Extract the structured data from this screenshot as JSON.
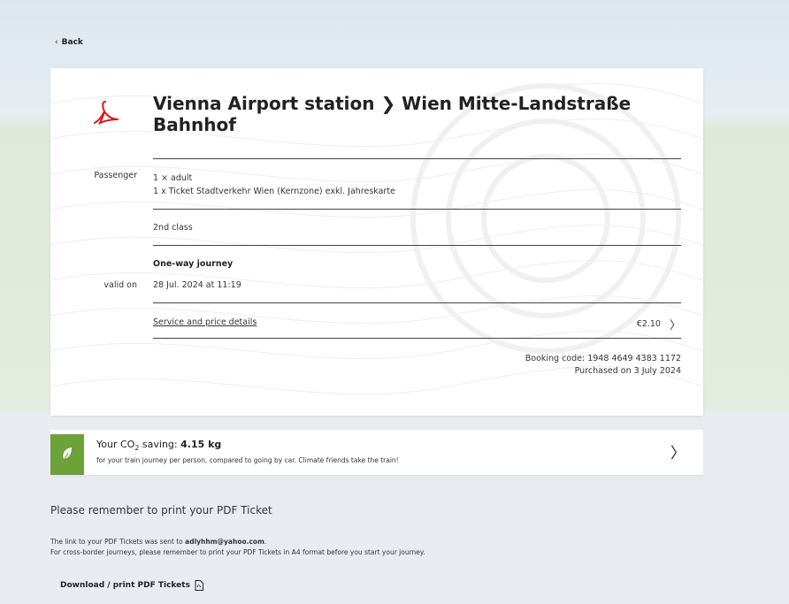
{
  "nav": {
    "back_label": "Back"
  },
  "ticket": {
    "title": "Vienna Airport station ❯ Wien Mitte-Landstraße Bahnhof",
    "passenger_label": "Passenger",
    "passenger_count": "1 × adult",
    "ticket_type": "1 x Ticket Stadtverkehr Wien (Kernzone) exkl. Jahreskarte",
    "class": "2nd class",
    "journey_type": "One-way journey",
    "valid_on_label": "valid on",
    "valid_on": "28 Jul. 2024 at 11:19",
    "service_link": "Service and price details",
    "price": "€2.10",
    "booking_code": "Booking code: 1948 4649 4383 1172",
    "purchased_on": "Purchased on 3 July 2024"
  },
  "co2": {
    "prefix": "Your CO",
    "subscript": "2",
    "middle": " saving: ",
    "amount": "4.15 kg",
    "note": "for your train journey per person, compared to going by car. Climate friends take the train!",
    "accent_color": "#6da23a"
  },
  "print": {
    "heading": "Please remember to print your PDF Ticket",
    "line1_prefix": "The link to your PDF Tickets was sent to ",
    "email": "adlyhhm@yahoo.com",
    "line1_suffix": ".",
    "line2": "For cross-border journeys, please remember to print your PDF Tickets in A4 format before you start your journey.",
    "download_label": "Download / print PDF Tickets"
  },
  "icons": {
    "back": "chevron-left-icon",
    "pdf": "acrobat-pdf-icon",
    "price_chevron": "chevron-right-icon",
    "leaf": "leaf-icon",
    "download": "pdf-file-icon"
  }
}
